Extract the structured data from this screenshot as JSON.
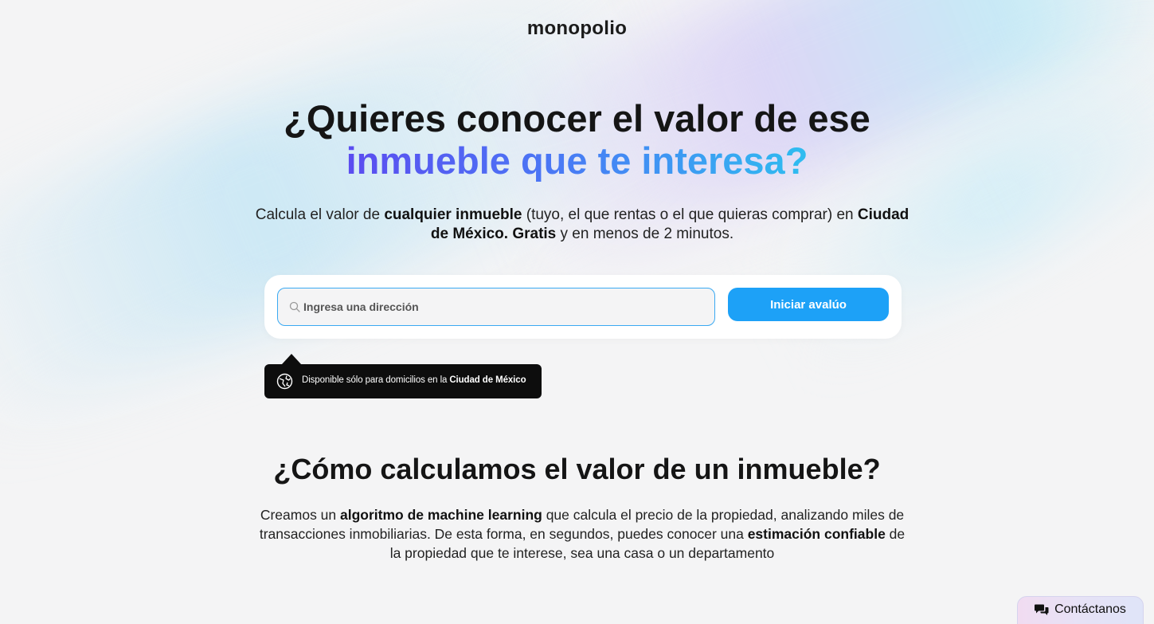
{
  "brand": {
    "logo_text": "monopolio"
  },
  "hero": {
    "title_line1": "¿Quieres conocer el valor de ese",
    "title_line2": "inmueble que te interesa?",
    "subtitle_parts": [
      {
        "text": "Calcula el valor de ",
        "bold": false
      },
      {
        "text": "cualquier inmueble",
        "bold": true
      },
      {
        "text": " (tuyo, el que rentas o el que quieras comprar) en ",
        "bold": false
      },
      {
        "text": "Ciudad de México. Gratis",
        "bold": true
      },
      {
        "text": " y en menos de 2 minutos.",
        "bold": false
      }
    ]
  },
  "search": {
    "placeholder": "Ingresa una dirección",
    "value": "",
    "button_label": "Iniciar avalúo",
    "icon": "search-icon"
  },
  "tooltip": {
    "text": "Disponible sólo para domicilios en la",
    "highlight": "Ciudad de México",
    "icon": "location-globe-icon"
  },
  "how": {
    "title": "¿Cómo calculamos el valor de un inmueble?",
    "text_parts": [
      {
        "text": "Creamos un ",
        "bold": false
      },
      {
        "text": "algoritmo de machine learning",
        "bold": true
      },
      {
        "text": " que calcula el precio de la propiedad, analizando miles de transacciones inmobiliarias. De esta forma, en segundos, puedes conocer una ",
        "bold": false
      },
      {
        "text": "estimación confiable",
        "bold": true
      },
      {
        "text": " de la propiedad que te interese, sea una casa o un departamento",
        "bold": false
      }
    ]
  },
  "contact": {
    "label": "Contáctanos",
    "icon": "chat-bubbles-icon"
  },
  "colors": {
    "primary": "#1da1f7",
    "gradient_start": "#5b4cf0",
    "gradient_end": "#2fbdf0",
    "tooltip_bg": "#0d0d0d"
  }
}
